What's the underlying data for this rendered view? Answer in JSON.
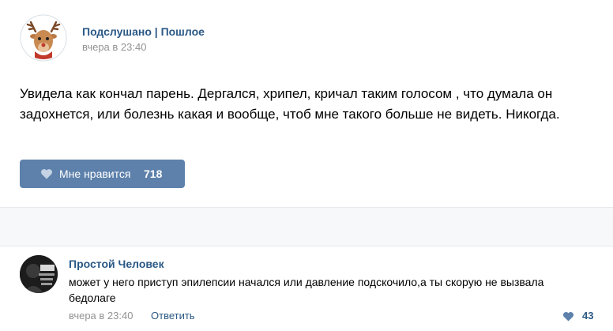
{
  "colors": {
    "link": "#2a5885",
    "muted": "#939393",
    "like_button_bg": "#5d81ab",
    "divider_bg": "#f7f8fa"
  },
  "post": {
    "author": "Подслушано | Пошлое",
    "time": "вчера в 23:40",
    "avatar_icon": "deer-avatar-icon",
    "text": "Увидела как кончал парень. Дергался, хрипел, кричал таким голосом , что думала он задохнется, или болезнь какая и вообще, чтоб мне такого больше не видеть. Никогда.",
    "like_button": {
      "icon": "heart-icon",
      "label": "Мне нравится",
      "count": "718"
    }
  },
  "comment": {
    "author": "Простой Человек",
    "avatar_icon": "user-avatar-icon",
    "text": "может у него приступ эпилепсии начался или давление подскочило,а ты скорую не вызвала бедолаге",
    "time": "вчера в 23:40",
    "reply_label": "Ответить",
    "like": {
      "icon": "heart-icon",
      "count": "43"
    }
  }
}
